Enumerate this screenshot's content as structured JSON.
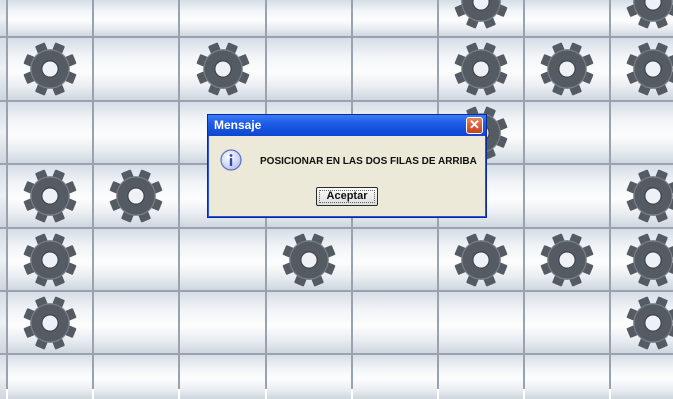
{
  "board": {
    "rows": 7,
    "columns": 9,
    "cells": [
      [
        0,
        0,
        0,
        0,
        0,
        0,
        1,
        0,
        1
      ],
      [
        0,
        1,
        0,
        1,
        0,
        0,
        1,
        1,
        1
      ],
      [
        0,
        0,
        0,
        0,
        0,
        0,
        1,
        0,
        0
      ],
      [
        0,
        1,
        1,
        0,
        0,
        0,
        0,
        0,
        1
      ],
      [
        0,
        1,
        0,
        0,
        1,
        0,
        1,
        1,
        1
      ],
      [
        0,
        1,
        0,
        0,
        0,
        0,
        0,
        0,
        1
      ],
      [
        0,
        0,
        0,
        0,
        0,
        0,
        0,
        0,
        0
      ]
    ],
    "piece_icon": "gear-icon",
    "colors": {
      "gear": "#555b63",
      "grid_line": "#9aa3ad",
      "cell_light": "#fdfdfd",
      "cell_dark": "#cfd6df"
    }
  },
  "dialog": {
    "title": "Mensaje",
    "close_symbol": "✕",
    "icon": "info-icon",
    "message": "POSICIONAR EN LAS DOS FILAS DE ARRIBA",
    "ok_label": "Aceptar",
    "colors": {
      "titlebar": "#1e5ce6",
      "body": "#ece9d8",
      "close": "#d4552e"
    }
  }
}
